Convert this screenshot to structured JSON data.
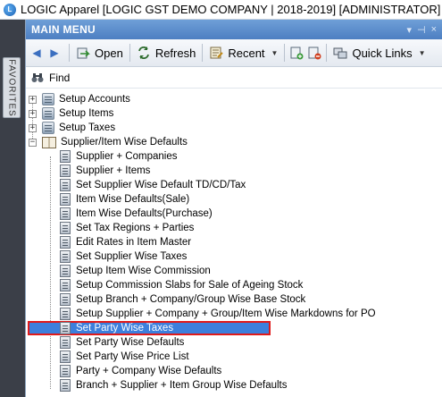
{
  "window": {
    "title": "LOGIC Apparel [LOGIC GST DEMO COMPANY | 2018-2019] [ADMINISTRATOR]",
    "logo_text": "L"
  },
  "sidebar": {
    "favorites_label": "FAVORITES"
  },
  "panel": {
    "title": "MAIN MENU",
    "controls": [
      "▾",
      "⊣",
      "×"
    ]
  },
  "toolbar": {
    "back_icon": "◀",
    "forward_icon": "▶",
    "open_label": "Open",
    "refresh_label": "Refresh",
    "recent_label": "Recent",
    "quick_links_label": "Quick Links",
    "dropdown_caret": "▼"
  },
  "find": {
    "label": "Find"
  },
  "tree": {
    "expander_collapsed": "+",
    "expander_expanded": "−",
    "top_nodes": [
      {
        "label": "Setup Accounts",
        "expanded": false
      },
      {
        "label": "Setup Items",
        "expanded": false
      },
      {
        "label": "Setup Taxes",
        "expanded": false
      },
      {
        "label": "Supplier/Item Wise Defaults",
        "expanded": true
      }
    ],
    "children": [
      "Supplier + Companies",
      "Supplier + Items",
      "Set Supplier Wise Default TD/CD/Tax",
      "Item Wise Defaults(Sale)",
      "Item Wise Defaults(Purchase)",
      "Set Tax Regions + Parties",
      "Edit Rates in Item Master",
      "Set Supplier Wise Taxes",
      "Setup Item Wise Commission",
      "Setup Commission Slabs for Sale of Ageing Stock",
      "Setup Branch + Company/Group Wise Base Stock",
      "Setup Supplier + Company + Group/Item Wise Markdowns for PO",
      "Set Party Wise Taxes",
      "Set Party Wise Defaults",
      "Set Party Wise Price List",
      "Party + Company Wise Defaults",
      "Branch + Supplier + Item Group Wise Defaults"
    ],
    "selected_child": "Set Party Wise Taxes"
  },
  "colors": {
    "header_blue": "#4d7fc2",
    "selection_blue": "#3d7fdc",
    "selection_border_red": "#e01a1a",
    "left_strip": "#3b3f48"
  }
}
